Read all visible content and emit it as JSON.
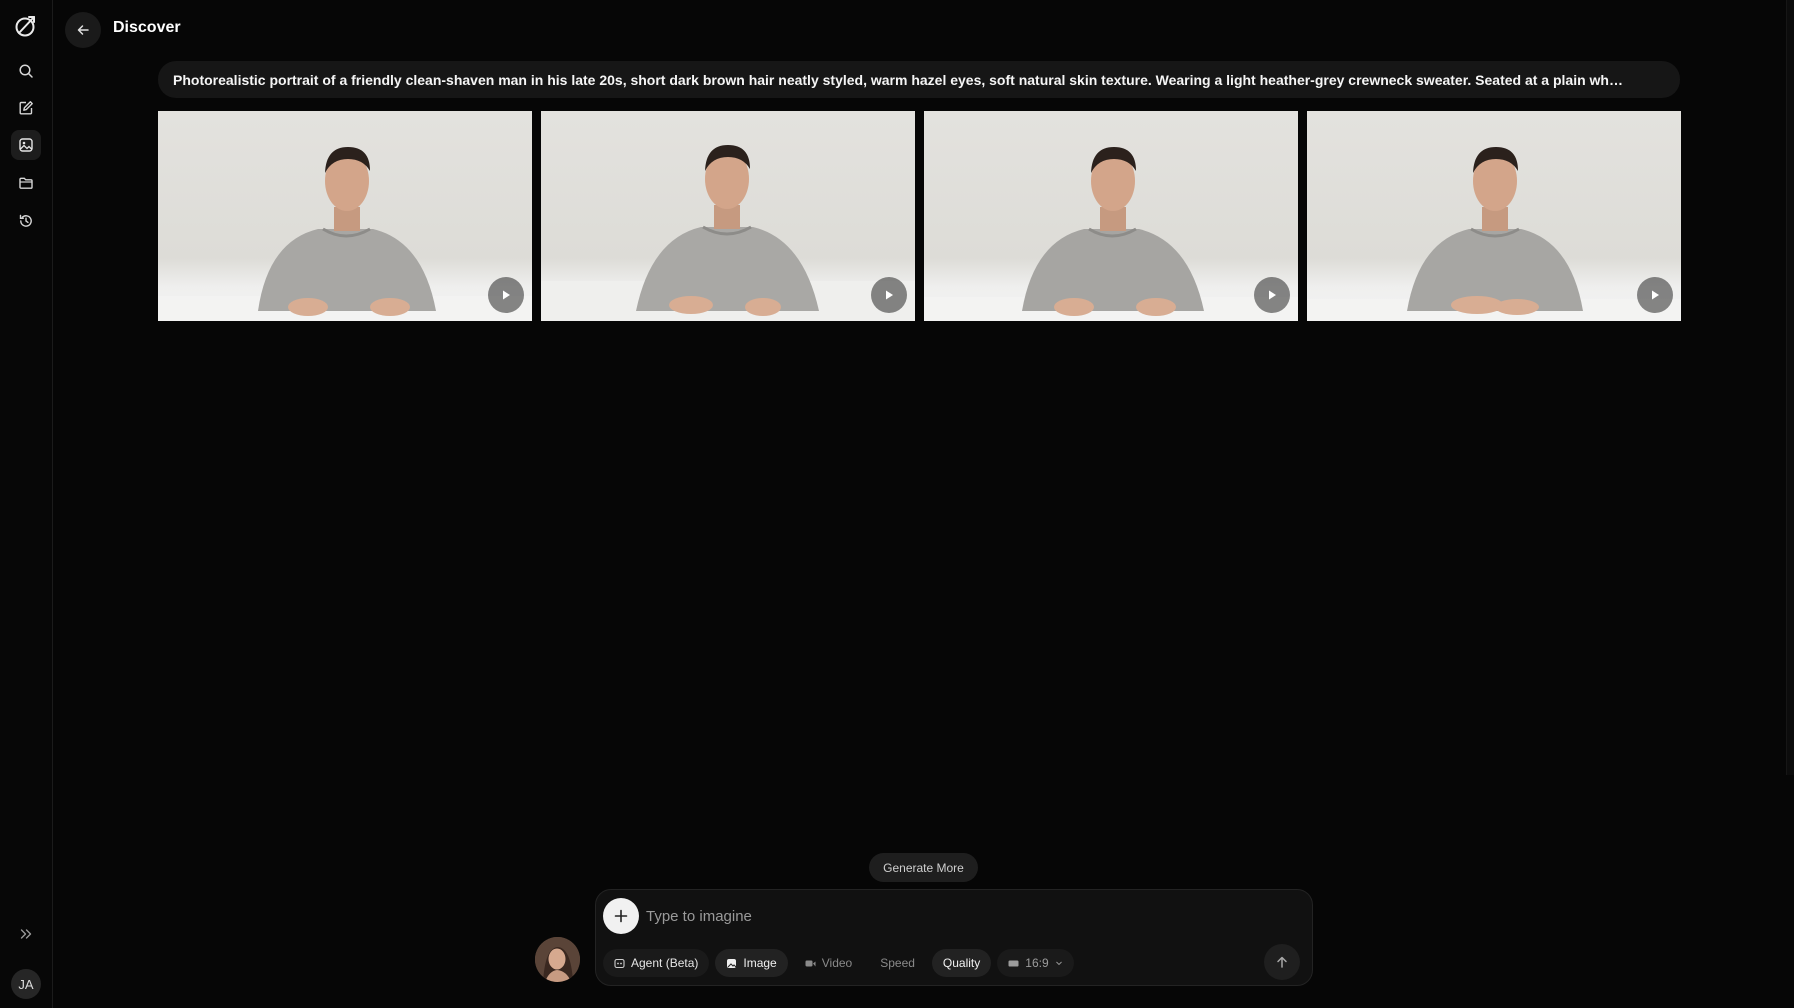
{
  "header": {
    "title": "Discover"
  },
  "sidebar": {
    "items": [
      {
        "icon": "search-icon"
      },
      {
        "icon": "edit-icon"
      },
      {
        "icon": "gallery-icon",
        "active": true
      },
      {
        "icon": "folder-icon"
      },
      {
        "icon": "history-icon"
      }
    ],
    "expand_icon": "double-chevron-right-icon",
    "user_initials": "JA"
  },
  "prompt": {
    "text": "Photorealistic portrait of a friendly clean-shaven man in his late 20s, short dark brown hair neatly styled, warm hazel eyes, soft natural skin texture. Wearing a light heather-grey crewneck sweater. Seated at a plain wh…"
  },
  "images": [
    {
      "alt": "Generated portrait 1"
    },
    {
      "alt": "Generated portrait 2"
    },
    {
      "alt": "Generated portrait 3"
    },
    {
      "alt": "Generated portrait 4"
    }
  ],
  "generate_more_label": "Generate More",
  "composer": {
    "placeholder": "Type to imagine",
    "chips": {
      "agent": "Agent (Beta)",
      "image": "Image",
      "video": "Video",
      "speed": "Speed",
      "quality": "Quality",
      "ratio": "16:9"
    }
  },
  "colors": {
    "background": "#060606",
    "surface": "#161616",
    "accent": "#f1f1f1"
  }
}
